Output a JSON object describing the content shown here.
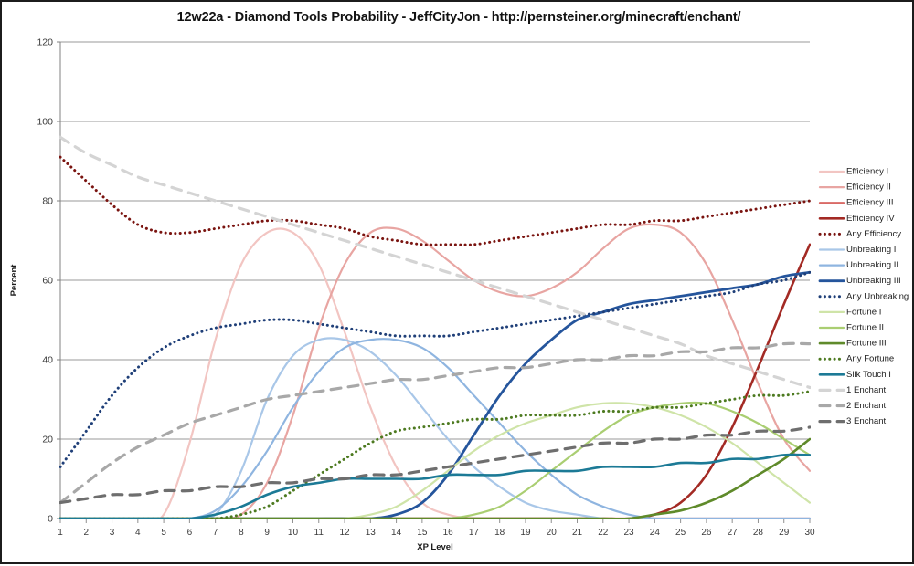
{
  "chart_data": {
    "type": "line",
    "title": "12w22a - Diamond Tools Probability - JeffCityJon - http://pernsteiner.org/minecraft/enchant/",
    "xlabel": "XP Level",
    "ylabel": "Percent",
    "xlim": [
      1,
      30
    ],
    "ylim": [
      0,
      120
    ],
    "yticks": [
      0,
      20,
      40,
      60,
      80,
      100,
      120
    ],
    "xticks": [
      1,
      2,
      3,
      4,
      5,
      6,
      7,
      8,
      9,
      10,
      11,
      12,
      13,
      14,
      15,
      16,
      17,
      18,
      19,
      20,
      21,
      22,
      23,
      24,
      25,
      26,
      27,
      28,
      29,
      30
    ],
    "grid": true,
    "legend_position": "right",
    "x": [
      1,
      2,
      3,
      4,
      5,
      6,
      7,
      8,
      9,
      10,
      11,
      12,
      13,
      14,
      15,
      16,
      17,
      18,
      19,
      20,
      21,
      22,
      23,
      24,
      25,
      26,
      27,
      28,
      29,
      30
    ],
    "series": [
      {
        "name": "Efficiency I",
        "color": "#f2c5c2",
        "style": "solid",
        "width": 2.2,
        "values": [
          0,
          0,
          0,
          0,
          1,
          19,
          45,
          64,
          72,
          72,
          64,
          47,
          28,
          13,
          4,
          1,
          0,
          0,
          0,
          0,
          0,
          0,
          0,
          0,
          0,
          0,
          0,
          0,
          0,
          0
        ]
      },
      {
        "name": "Efficiency II",
        "color": "#e8a5a2",
        "style": "solid",
        "width": 2.2,
        "values": [
          0,
          0,
          0,
          0,
          0,
          0,
          0,
          1,
          9,
          26,
          48,
          64,
          72,
          73,
          70,
          65,
          60,
          57,
          56,
          58,
          62,
          68,
          73,
          74,
          72,
          64,
          50,
          34,
          20,
          12
        ]
      },
      {
        "name": "Efficiency III",
        "color": "#d96a66",
        "style": "solid",
        "width": 2.2,
        "values": [
          0,
          0,
          0,
          0,
          0,
          0,
          0,
          0,
          0,
          0,
          0,
          0,
          0,
          0,
          0,
          0,
          0,
          0,
          0,
          0,
          0,
          0,
          0,
          0,
          0,
          0,
          0,
          0,
          0,
          0
        ]
      },
      {
        "name": "Efficiency IV",
        "color": "#a32a24",
        "style": "solid",
        "width": 2.6,
        "values": [
          0,
          0,
          0,
          0,
          0,
          0,
          0,
          0,
          0,
          0,
          0,
          0,
          0,
          0,
          0,
          0,
          0,
          0,
          0,
          0,
          0,
          0,
          0,
          1,
          4,
          11,
          23,
          38,
          54,
          69
        ]
      },
      {
        "name": "Any Efficiency",
        "color": "#7a1410",
        "style": "dotted",
        "width": 3.0,
        "values": [
          91,
          85,
          79,
          74,
          72,
          72,
          73,
          74,
          75,
          75,
          74,
          73,
          71,
          70,
          69,
          69,
          69,
          70,
          71,
          72,
          73,
          74,
          74,
          75,
          75,
          76,
          77,
          78,
          79,
          80
        ]
      },
      {
        "name": "Unbreaking I",
        "color": "#a9c7e8",
        "style": "solid",
        "width": 2.2,
        "values": [
          0,
          0,
          0,
          0,
          0,
          0,
          1,
          12,
          30,
          41,
          45,
          45,
          42,
          36,
          28,
          20,
          13,
          8,
          4,
          2,
          1,
          0,
          0,
          0,
          0,
          0,
          0,
          0,
          0,
          0
        ]
      },
      {
        "name": "Unbreaking II",
        "color": "#8fb5e0",
        "style": "solid",
        "width": 2.2,
        "values": [
          0,
          0,
          0,
          0,
          0,
          0,
          2,
          8,
          17,
          28,
          37,
          43,
          45,
          45,
          43,
          38,
          31,
          24,
          17,
          11,
          6,
          3,
          1,
          0,
          0,
          0,
          0,
          0,
          0,
          0
        ]
      },
      {
        "name": "Unbreaking III",
        "color": "#25559c",
        "style": "solid",
        "width": 2.8,
        "values": [
          0,
          0,
          0,
          0,
          0,
          0,
          0,
          0,
          0,
          0,
          0,
          0,
          0,
          1,
          4,
          11,
          21,
          31,
          39,
          45,
          50,
          52,
          54,
          55,
          56,
          57,
          58,
          59,
          61,
          62
        ]
      },
      {
        "name": "Any Unbreaking",
        "color": "#1f3f78",
        "style": "dotted",
        "width": 3.0,
        "values": [
          13,
          22,
          31,
          38,
          43,
          46,
          48,
          49,
          50,
          50,
          49,
          48,
          47,
          46,
          46,
          46,
          47,
          48,
          49,
          50,
          51,
          52,
          53,
          54,
          55,
          56,
          57,
          59,
          60,
          62
        ]
      },
      {
        "name": "Fortune I",
        "color": "#cfe4a8",
        "style": "solid",
        "width": 2.2,
        "values": [
          0,
          0,
          0,
          0,
          0,
          0,
          0,
          0,
          0,
          0,
          0,
          0,
          1,
          3,
          7,
          12,
          17,
          21,
          24,
          26,
          28,
          29,
          29,
          28,
          26,
          23,
          19,
          14,
          9,
          4
        ]
      },
      {
        "name": "Fortune II",
        "color": "#aace72",
        "style": "solid",
        "width": 2.2,
        "values": [
          0,
          0,
          0,
          0,
          0,
          0,
          0,
          0,
          0,
          0,
          0,
          0,
          0,
          0,
          0,
          0,
          1,
          3,
          7,
          12,
          17,
          22,
          26,
          28,
          29,
          29,
          27,
          24,
          20,
          16
        ]
      },
      {
        "name": "Fortune III",
        "color": "#5f8a2a",
        "style": "solid",
        "width": 2.6,
        "values": [
          0,
          0,
          0,
          0,
          0,
          0,
          0,
          0,
          0,
          0,
          0,
          0,
          0,
          0,
          0,
          0,
          0,
          0,
          0,
          0,
          0,
          0,
          0,
          1,
          2,
          4,
          7,
          11,
          15,
          20
        ]
      },
      {
        "name": "Any Fortune",
        "color": "#4d7a20",
        "style": "dotted",
        "width": 3.0,
        "values": [
          0,
          0,
          0,
          0,
          0,
          0,
          0,
          1,
          3,
          7,
          11,
          15,
          19,
          22,
          23,
          24,
          25,
          25,
          26,
          26,
          26,
          27,
          27,
          28,
          28,
          29,
          30,
          31,
          31,
          32
        ]
      },
      {
        "name": "Silk Touch I",
        "color": "#1c7a96",
        "style": "solid",
        "width": 2.6,
        "values": [
          0,
          0,
          0,
          0,
          0,
          0,
          1,
          3,
          6,
          8,
          9,
          10,
          10,
          10,
          10,
          11,
          11,
          11,
          12,
          12,
          12,
          13,
          13,
          13,
          14,
          14,
          15,
          15,
          16,
          16
        ]
      },
      {
        "name": "1 Enchant",
        "color": "#d4d4d4",
        "style": "dashed",
        "width": 3.2,
        "values": [
          96,
          92,
          89,
          86,
          84,
          82,
          80,
          78,
          76,
          74,
          72,
          70,
          68,
          66,
          64,
          62,
          60,
          58,
          56,
          54,
          52,
          50,
          48,
          46,
          44,
          41,
          39,
          37,
          35,
          33
        ]
      },
      {
        "name": "2 Enchant",
        "color": "#a8a8a8",
        "style": "dashed",
        "width": 3.2,
        "values": [
          4,
          9,
          14,
          18,
          21,
          24,
          26,
          28,
          30,
          31,
          32,
          33,
          34,
          35,
          35,
          36,
          37,
          38,
          38,
          39,
          40,
          40,
          41,
          41,
          42,
          42,
          43,
          43,
          44,
          44
        ]
      },
      {
        "name": "3 Enchant",
        "color": "#6e6e6e",
        "style": "dashed",
        "width": 3.2,
        "values": [
          4,
          5,
          6,
          6,
          7,
          7,
          8,
          8,
          9,
          9,
          10,
          10,
          11,
          11,
          12,
          13,
          14,
          15,
          16,
          17,
          18,
          19,
          19,
          20,
          20,
          21,
          21,
          22,
          22,
          23
        ]
      }
    ]
  }
}
